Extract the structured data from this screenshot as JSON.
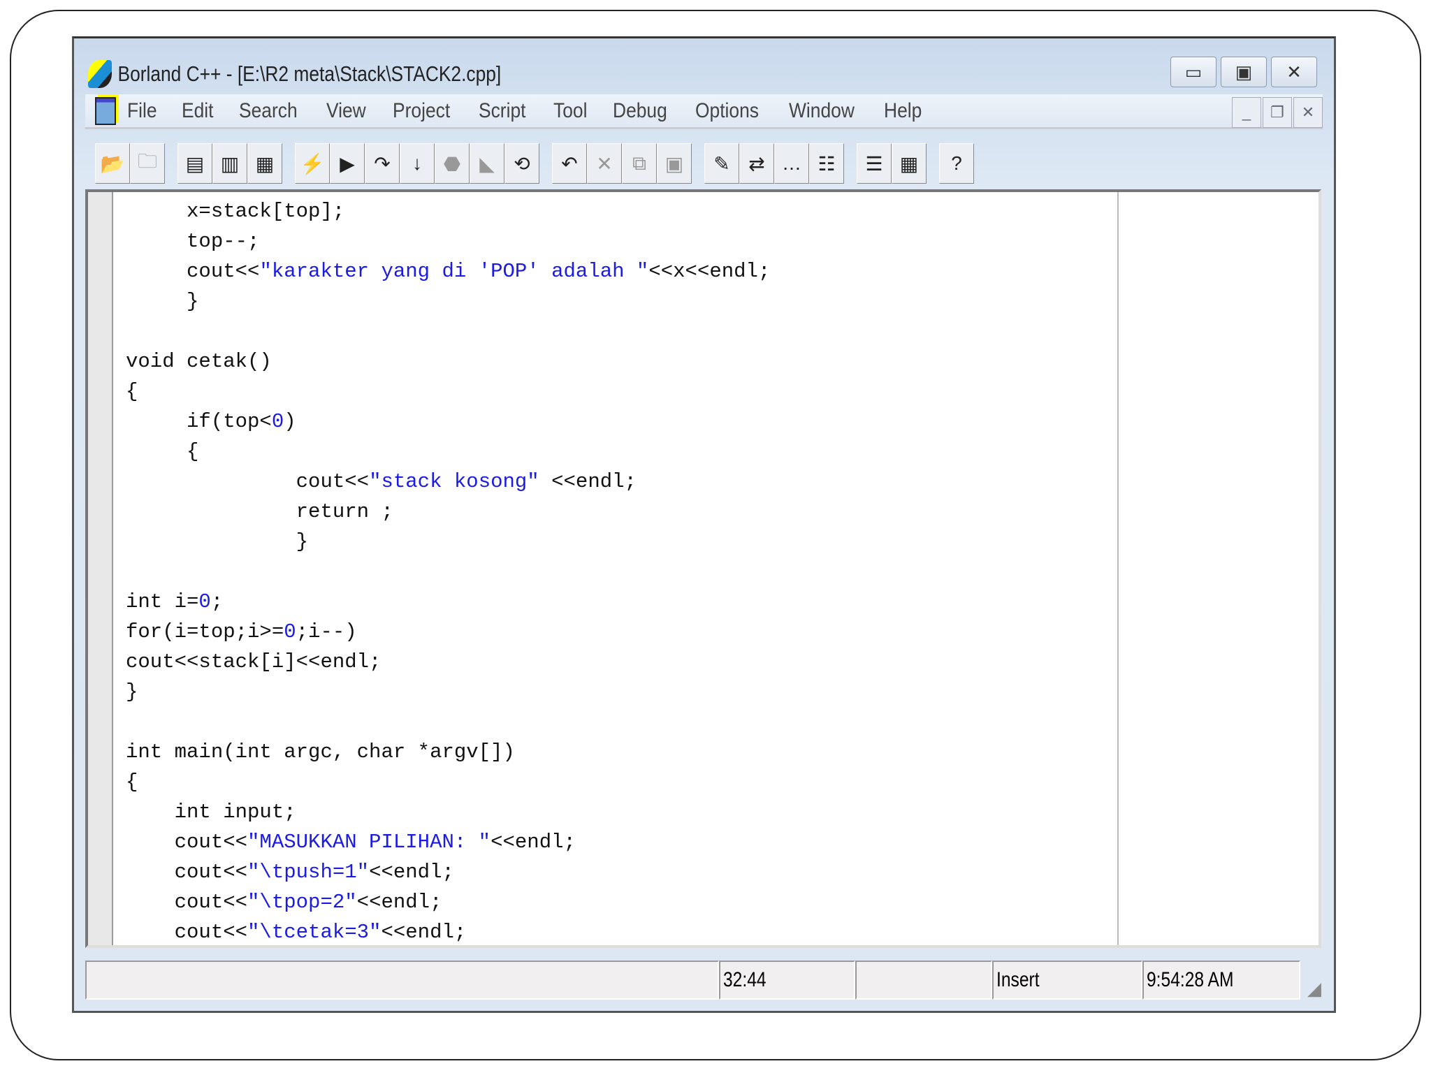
{
  "window": {
    "title": "Borland C++ - [E:\\R2 meta\\Stack\\STACK2.cpp]",
    "controls": [
      "minimize",
      "maximize",
      "close"
    ]
  },
  "menu": [
    "File",
    "Edit",
    "Search",
    "View",
    "Project",
    "Script",
    "Tool",
    "Debug",
    "Options",
    "Window",
    "Help"
  ],
  "toolbar": [
    {
      "icon": "open-project-icon",
      "g": 0
    },
    {
      "icon": "close-project-icon",
      "g": 0,
      "dis": true
    },
    {
      "icon": "compile-icon",
      "g": 1
    },
    {
      "icon": "make-icon",
      "g": 1
    },
    {
      "icon": "build-all-icon",
      "g": 1
    },
    {
      "icon": "run-icon",
      "g": 2
    },
    {
      "icon": "debug-run-icon",
      "g": 2
    },
    {
      "icon": "step-over-icon",
      "g": 2
    },
    {
      "icon": "trace-into-icon",
      "g": 2
    },
    {
      "icon": "breakpoint-icon",
      "g": 2,
      "dis": true
    },
    {
      "icon": "run-to-cursor-icon",
      "g": 2,
      "dis": true
    },
    {
      "icon": "reset-icon",
      "g": 2
    },
    {
      "icon": "undo-icon",
      "g": 3
    },
    {
      "icon": "cut-icon",
      "g": 3,
      "dis": true
    },
    {
      "icon": "copy-icon",
      "g": 3,
      "dis": true
    },
    {
      "icon": "paste-icon",
      "g": 3,
      "dis": true
    },
    {
      "icon": "find-icon",
      "g": 4
    },
    {
      "icon": "replace-icon",
      "g": 4
    },
    {
      "icon": "search-again-icon",
      "g": 4
    },
    {
      "icon": "browse-symbol-icon",
      "g": 4
    },
    {
      "icon": "message-window-icon",
      "g": 5
    },
    {
      "icon": "project-window-icon",
      "g": 5
    },
    {
      "icon": "context-help-icon",
      "g": 6
    }
  ],
  "code": [
    [
      [
        "     x=stack[top];",
        ""
      ]
    ],
    [
      [
        "     top--;",
        ""
      ]
    ],
    [
      [
        "     cout<<",
        ""
      ],
      [
        "\"karakter yang di 'POP' adalah \"",
        "s"
      ],
      [
        "<<x<<endl;",
        ""
      ]
    ],
    [
      [
        "     }",
        ""
      ]
    ],
    [
      [
        "",
        ""
      ]
    ],
    [
      [
        "void cetak()",
        ""
      ]
    ],
    [
      [
        "{",
        ""
      ]
    ],
    [
      [
        "     if(top<",
        ""
      ],
      [
        "0",
        "n"
      ],
      [
        ")",
        ""
      ]
    ],
    [
      [
        "     {",
        ""
      ]
    ],
    [
      [
        "              cout<<",
        ""
      ],
      [
        "\"stack kosong\"",
        "s"
      ],
      [
        " <<endl;",
        ""
      ]
    ],
    [
      [
        "              return ;",
        ""
      ]
    ],
    [
      [
        "              }",
        ""
      ]
    ],
    [
      [
        "",
        ""
      ]
    ],
    [
      [
        "int i=",
        ""
      ],
      [
        "0",
        "n"
      ],
      [
        ";",
        ""
      ]
    ],
    [
      [
        "for(i=top;i>=",
        ""
      ],
      [
        "0",
        "n"
      ],
      [
        ";i--)",
        ""
      ]
    ],
    [
      [
        "cout<<stack[i]<<endl;",
        ""
      ]
    ],
    [
      [
        "}",
        ""
      ]
    ],
    [
      [
        "",
        ""
      ]
    ],
    [
      [
        "int main(int argc, char *argv[])",
        ""
      ]
    ],
    [
      [
        "{",
        ""
      ]
    ],
    [
      [
        "    int input;",
        ""
      ]
    ],
    [
      [
        "    cout<<",
        ""
      ],
      [
        "\"MASUKKAN PILIHAN: \"",
        "s"
      ],
      [
        "<<endl;",
        ""
      ]
    ],
    [
      [
        "    cout<<",
        ""
      ],
      [
        "\"\\tpush=1\"",
        "s"
      ],
      [
        "<<endl;",
        ""
      ]
    ],
    [
      [
        "    cout<<",
        ""
      ],
      [
        "\"\\tpop=2\"",
        "s"
      ],
      [
        "<<endl;",
        ""
      ]
    ],
    [
      [
        "    cout<<",
        ""
      ],
      [
        "\"\\tcetak=3\"",
        "s"
      ],
      [
        "<<endl;",
        ""
      ]
    ]
  ],
  "status": {
    "message": "",
    "position": "32:44",
    "modified": "",
    "mode": "Insert",
    "time": "9:54:28 AM"
  }
}
